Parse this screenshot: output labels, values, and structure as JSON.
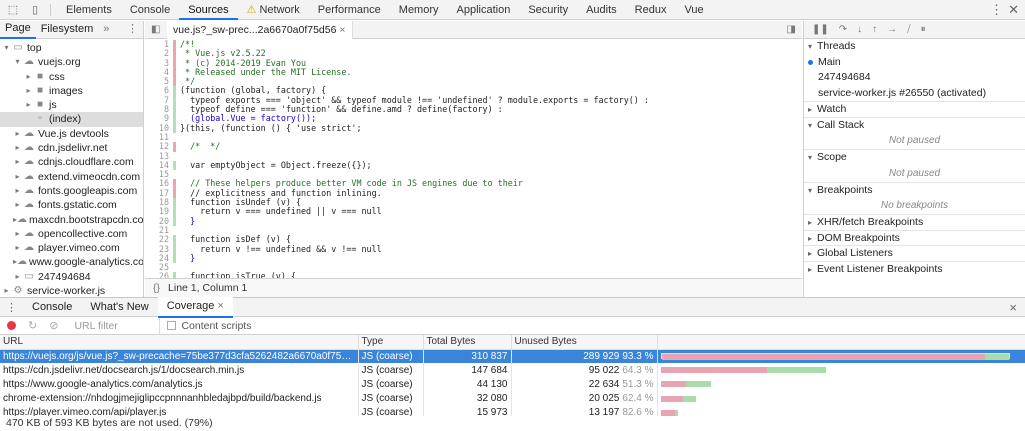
{
  "toolbar": {
    "tabs": [
      "Elements",
      "Console",
      "Sources",
      "Network",
      "Performance",
      "Memory",
      "Application",
      "Security",
      "Audits",
      "Redux",
      "Vue"
    ],
    "active": "Sources"
  },
  "navigator": {
    "tabs": [
      "Page",
      "Filesystem"
    ],
    "more": "»",
    "items": [
      {
        "label": "top",
        "depth": 0,
        "arrow": "▾",
        "icon": "frame-icon"
      },
      {
        "label": "vuejs.org",
        "depth": 1,
        "arrow": "▾",
        "icon": "cloud-icon"
      },
      {
        "label": "css",
        "depth": 2,
        "arrow": "▸",
        "icon": "folder-icon"
      },
      {
        "label": "images",
        "depth": 2,
        "arrow": "▸",
        "icon": "folder-icon"
      },
      {
        "label": "js",
        "depth": 2,
        "arrow": "▸",
        "icon": "folder-icon"
      },
      {
        "label": "(index)",
        "depth": 2,
        "arrow": "",
        "icon": "file-icon"
      },
      {
        "label": "Vue.js devtools",
        "depth": 1,
        "arrow": "▸",
        "icon": "cloud-icon"
      },
      {
        "label": "cdn.jsdelivr.net",
        "depth": 1,
        "arrow": "▸",
        "icon": "cloud-icon"
      },
      {
        "label": "cdnjs.cloudflare.com",
        "depth": 1,
        "arrow": "▸",
        "icon": "cloud-icon"
      },
      {
        "label": "extend.vimeocdn.com",
        "depth": 1,
        "arrow": "▸",
        "icon": "cloud-icon"
      },
      {
        "label": "fonts.googleapis.com",
        "depth": 1,
        "arrow": "▸",
        "icon": "cloud-icon"
      },
      {
        "label": "fonts.gstatic.com",
        "depth": 1,
        "arrow": "▸",
        "icon": "cloud-icon"
      },
      {
        "label": "maxcdn.bootstrapcdn.com",
        "depth": 1,
        "arrow": "▸",
        "icon": "cloud-icon"
      },
      {
        "label": "opencollective.com",
        "depth": 1,
        "arrow": "▸",
        "icon": "cloud-icon"
      },
      {
        "label": "player.vimeo.com",
        "depth": 1,
        "arrow": "▸",
        "icon": "cloud-icon"
      },
      {
        "label": "www.google-analytics.com",
        "depth": 1,
        "arrow": "▸",
        "icon": "cloud-icon"
      },
      {
        "label": "247494684",
        "depth": 1,
        "arrow": "▸",
        "icon": "frame-icon"
      },
      {
        "label": "service-worker.js",
        "depth": 0,
        "arrow": "▸",
        "icon": "gear-icon"
      }
    ]
  },
  "editor": {
    "file_tab": "vue.js?_sw-prec...2a6670a0f75d56",
    "status": "Line 1, Column 1",
    "lines": [
      {
        "n": "1",
        "g": "red",
        "t": "/*!"
      },
      {
        "n": "2",
        "g": "red",
        "t": " * Vue.js v2.5.22"
      },
      {
        "n": "3",
        "g": "red",
        "t": " * (c) 2014-2019 Evan You"
      },
      {
        "n": "4",
        "g": "red",
        "t": " * Released under the MIT License."
      },
      {
        "n": "5",
        "g": "red",
        "t": " */"
      },
      {
        "n": "6",
        "g": "grn",
        "t": "(function (global, factory) {"
      },
      {
        "n": "7",
        "g": "grn",
        "t": "  typeof exports === 'object' && typeof module !== 'undefined' ? module.exports = factory() :"
      },
      {
        "n": "8",
        "g": "grn",
        "t": "  typeof define === 'function' && define.amd ? define(factory) :"
      },
      {
        "n": "9",
        "g": "grn",
        "t": "  (global.Vue = factory());"
      },
      {
        "n": "10",
        "g": "grn",
        "t": "}(this, (function () { 'use strict';"
      },
      {
        "n": "11",
        "g": "",
        "t": ""
      },
      {
        "n": "12",
        "g": "red",
        "t": "  /*  */"
      },
      {
        "n": "13",
        "g": "",
        "t": ""
      },
      {
        "n": "14",
        "g": "grn",
        "t": "  var emptyObject = Object.freeze({});"
      },
      {
        "n": "15",
        "g": "",
        "t": ""
      },
      {
        "n": "16",
        "g": "red",
        "t": "  // These helpers produce better VM code in JS engines due to their"
      },
      {
        "n": "17",
        "g": "red",
        "t": "  // explicitness and function inlining."
      },
      {
        "n": "18",
        "g": "grn",
        "t": "  function isUndef (v) {"
      },
      {
        "n": "19",
        "g": "grn",
        "t": "    return v === undefined || v === null"
      },
      {
        "n": "20",
        "g": "grn",
        "t": "  }"
      },
      {
        "n": "21",
        "g": "",
        "t": ""
      },
      {
        "n": "22",
        "g": "grn",
        "t": "  function isDef (v) {"
      },
      {
        "n": "23",
        "g": "grn",
        "t": "    return v !== undefined && v !== null"
      },
      {
        "n": "24",
        "g": "grn",
        "t": "  }"
      },
      {
        "n": "25",
        "g": "",
        "t": ""
      },
      {
        "n": "26",
        "g": "grn",
        "t": "  function isTrue (v) {"
      }
    ]
  },
  "debugger": {
    "threads_label": "Threads",
    "threads": [
      "Main",
      "247494684",
      "service-worker.js #26550 (activated)"
    ],
    "watch": "Watch",
    "callstack": "Call Stack",
    "not_paused": "Not paused",
    "scope": "Scope",
    "breakpoints": "Breakpoints",
    "no_breakpoints": "No breakpoints",
    "xhr": "XHR/fetch Breakpoints",
    "dom": "DOM Breakpoints",
    "global": "Global Listeners",
    "event": "Event Listener Breakpoints"
  },
  "drawer": {
    "tabs": [
      "Console",
      "What's New",
      "Coverage"
    ],
    "close": "×",
    "filter_placeholder": "URL filter",
    "content_scripts": "Content scripts",
    "columns": [
      "URL",
      "Type",
      "Total Bytes",
      "Unused Bytes"
    ],
    "rows": [
      {
        "url": "https://vuejs.org/js/vue.js?_sw-precache=75be377d3cfa5262482a6670a0f75d56",
        "type": "JS (coarse)",
        "total": "310 837",
        "unused": "289 929",
        "pct": "93.3 %",
        "unused_frac": 0.933,
        "bar_frac": 0.97
      },
      {
        "url": "https://cdn.jsdelivr.net/docsearch.js/1/docsearch.min.js",
        "type": "JS (coarse)",
        "total": "147 684",
        "unused": "95 022",
        "pct": "64.3 %",
        "unused_frac": 0.643,
        "bar_frac": 0.46
      },
      {
        "url": "https://www.google-analytics.com/analytics.js",
        "type": "JS (coarse)",
        "total": "44 130",
        "unused": "22 634",
        "pct": "51.3 %",
        "unused_frac": 0.513,
        "bar_frac": 0.14
      },
      {
        "url": "chrome-extension://nhdogjmejiglipccpnnnanhbledajbpd/build/backend.js",
        "type": "JS (coarse)",
        "total": "32 080",
        "unused": "20 025",
        "pct": "62.4 %",
        "unused_frac": 0.624,
        "bar_frac": 0.1
      },
      {
        "url": "https://player.vimeo.com/api/player.js",
        "type": "JS (coarse)",
        "total": "15 973",
        "unused": "13 197",
        "pct": "82.6 %",
        "unused_frac": 0.826,
        "bar_frac": 0.05
      }
    ],
    "footer": "470 KB of 593 KB bytes are not used. (79%)"
  }
}
